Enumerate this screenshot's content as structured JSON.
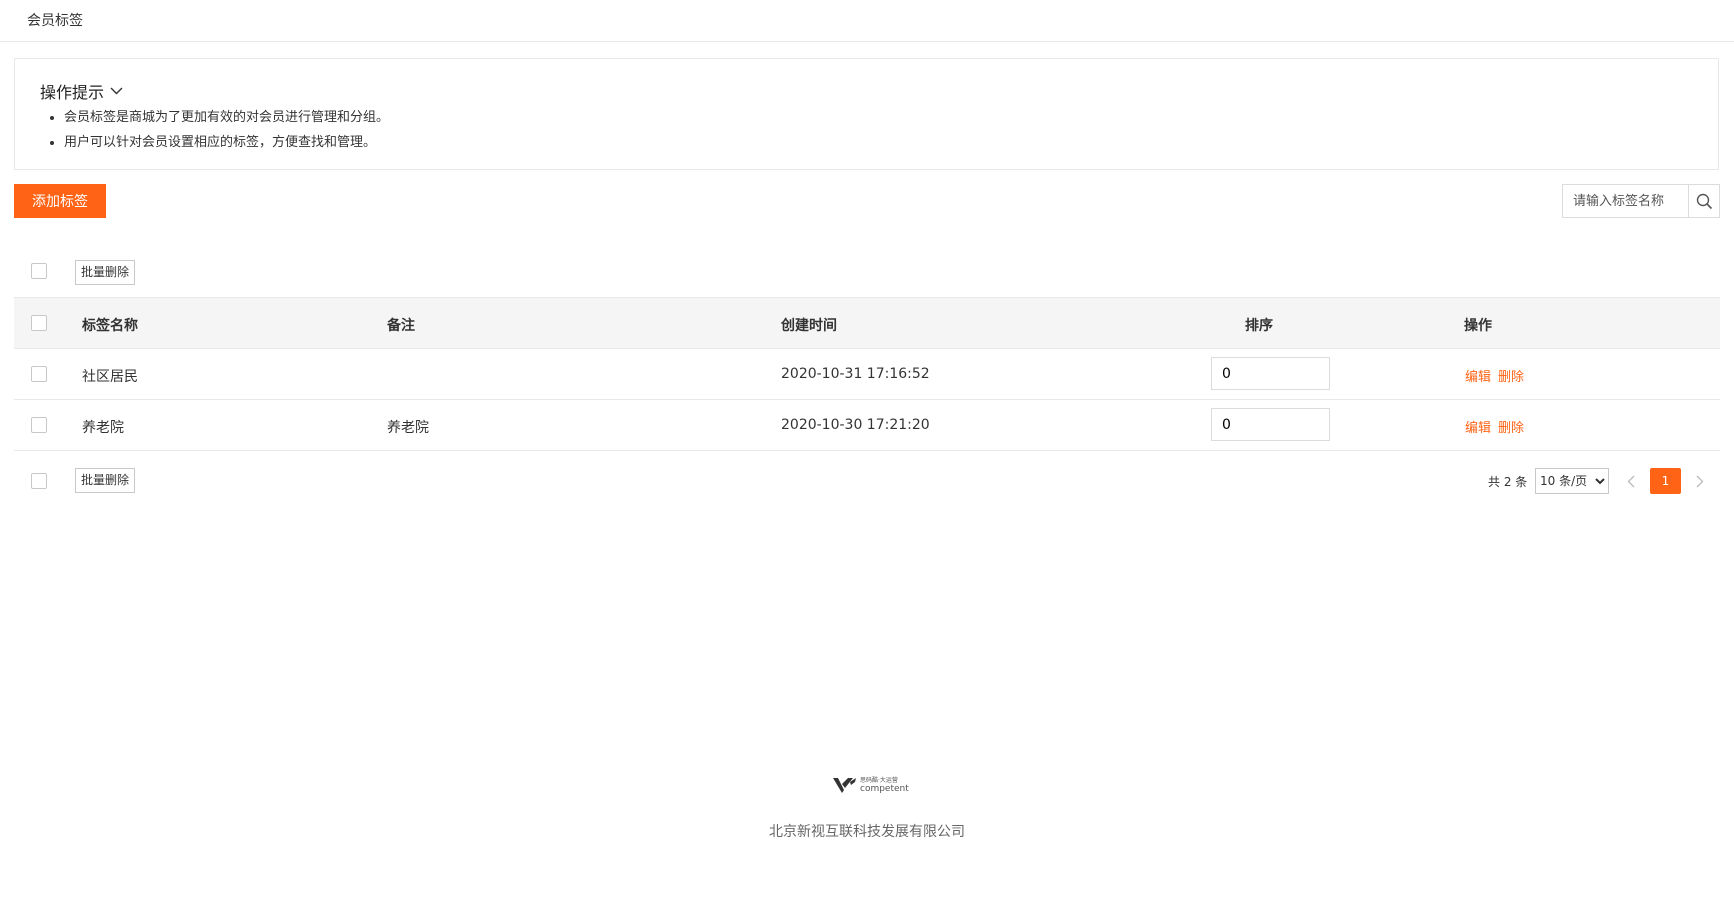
{
  "page": {
    "title": "会员标签"
  },
  "tips": {
    "title": "操作提示",
    "items": [
      "会员标签是商城为了更加有效的对会员进行管理和分组。",
      "用户可以针对会员设置相应的标签，方便查找和管理。"
    ]
  },
  "toolbar": {
    "add_label": "添加标签",
    "search_placeholder": "请输入标签名称",
    "batch_delete": "批量删除"
  },
  "table": {
    "headers": [
      "标签名称",
      "备注",
      "创建时间",
      "排序",
      "操作"
    ],
    "rows": [
      {
        "name": "社区居民",
        "remark": "",
        "created": "2020-10-31 17:16:52",
        "sort": "0",
        "edit": "编辑",
        "delete": "删除"
      },
      {
        "name": "养老院",
        "remark": "养老院",
        "created": "2020-10-30 17:21:20",
        "sort": "0",
        "edit": "编辑",
        "delete": "删除"
      }
    ]
  },
  "pagination": {
    "total": "共 2 条",
    "page_size": "10 条/页",
    "page_size_options": [
      "10 条/页"
    ],
    "current_page": "1"
  },
  "footer": {
    "logo_line1": "思码酷·大运营",
    "logo_line2": "competent",
    "company": "北京新视互联科技发展有限公司"
  },
  "colors": {
    "accent": "#ff6315",
    "border": "#e8e8e8",
    "header_bg": "#f5f5f5"
  },
  "icons": {
    "tips_toggle": "chevron-down-icon",
    "search": "search-icon",
    "prev": "chevron-left-icon",
    "next": "chevron-right-icon"
  }
}
